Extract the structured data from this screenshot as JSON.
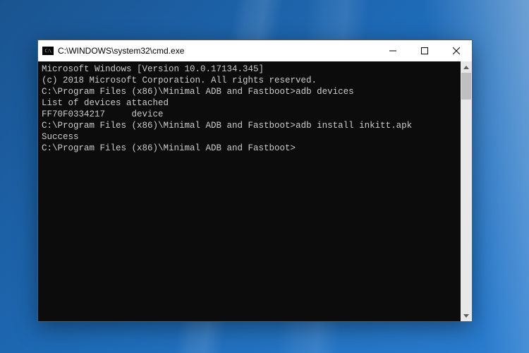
{
  "window": {
    "icon_text": "C:\\",
    "title": "C:\\WINDOWS\\system32\\cmd.exe"
  },
  "console": {
    "header1": "Microsoft Windows [Version 10.0.17134.345]",
    "header2": "(c) 2018 Microsoft Corporation. All rights reserved.",
    "blank": "",
    "prompt1_path": "C:\\Program Files (x86)\\Minimal ADB and Fastboot>",
    "prompt1_cmd": "adb devices",
    "list_header": "List of devices attached",
    "device_id": "FF70F0334217",
    "device_status": "device",
    "prompt2_path": "C:\\Program Files (x86)\\Minimal ADB and Fastboot>",
    "prompt2_cmd": "adb install inkitt.apk",
    "result": "Success",
    "prompt3_path": "C:\\Program Files (x86)\\Minimal ADB and Fastboot>"
  }
}
